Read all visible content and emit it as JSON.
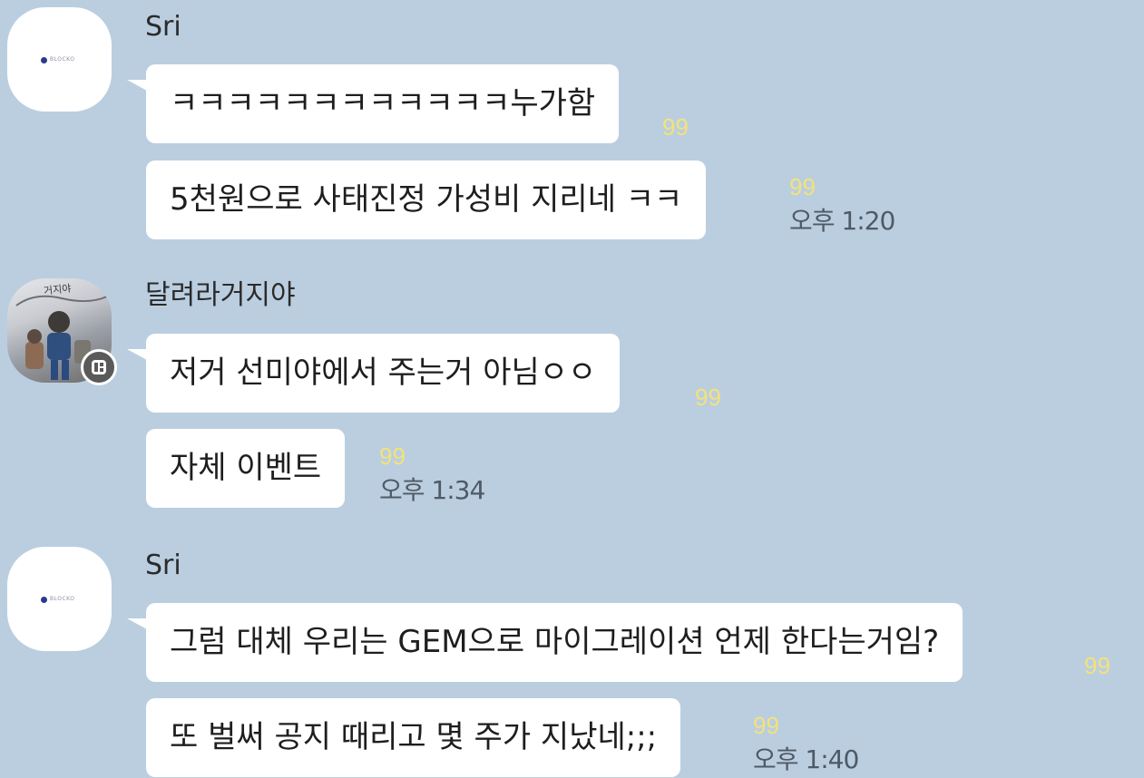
{
  "messages": [
    {
      "sender": "Sri",
      "avatar_logo_text": "BLOCKO",
      "bubbles": [
        {
          "text": "ㅋㅋㅋㅋㅋㅋㅋㅋㅋㅋㅋㅋ누가함",
          "unread": "99",
          "time": ""
        },
        {
          "text": "5천원으로 사태진정 가성비 지리네 ㅋㅋ",
          "unread": "99",
          "time": "오후 1:20"
        }
      ]
    },
    {
      "sender": "달려라거지야",
      "avatar_caption": "거지야",
      "bubbles": [
        {
          "text": "저거 선미야에서 주는거 아님ㅇㅇ",
          "unread": "99",
          "time": ""
        },
        {
          "text": "자체 이벤트",
          "unread": "99",
          "time": "오후 1:34"
        }
      ]
    },
    {
      "sender": "Sri",
      "avatar_logo_text": "BLOCKO",
      "bubbles": [
        {
          "text": "그럼 대체 우리는 GEM으로 마이그레이션 언제 한다는거임?",
          "unread": "99",
          "time": ""
        },
        {
          "text": "또 벌써 공지 때리고 몇 주가 지났네;;;",
          "unread": "99",
          "time": "오후 1:40"
        }
      ]
    }
  ],
  "colors": {
    "background": "#bacee0",
    "bubble": "#ffffff",
    "unread": "#f3e27a",
    "time": "#4f5a66"
  },
  "icons": {
    "status_badge": "bot-badge-icon"
  }
}
